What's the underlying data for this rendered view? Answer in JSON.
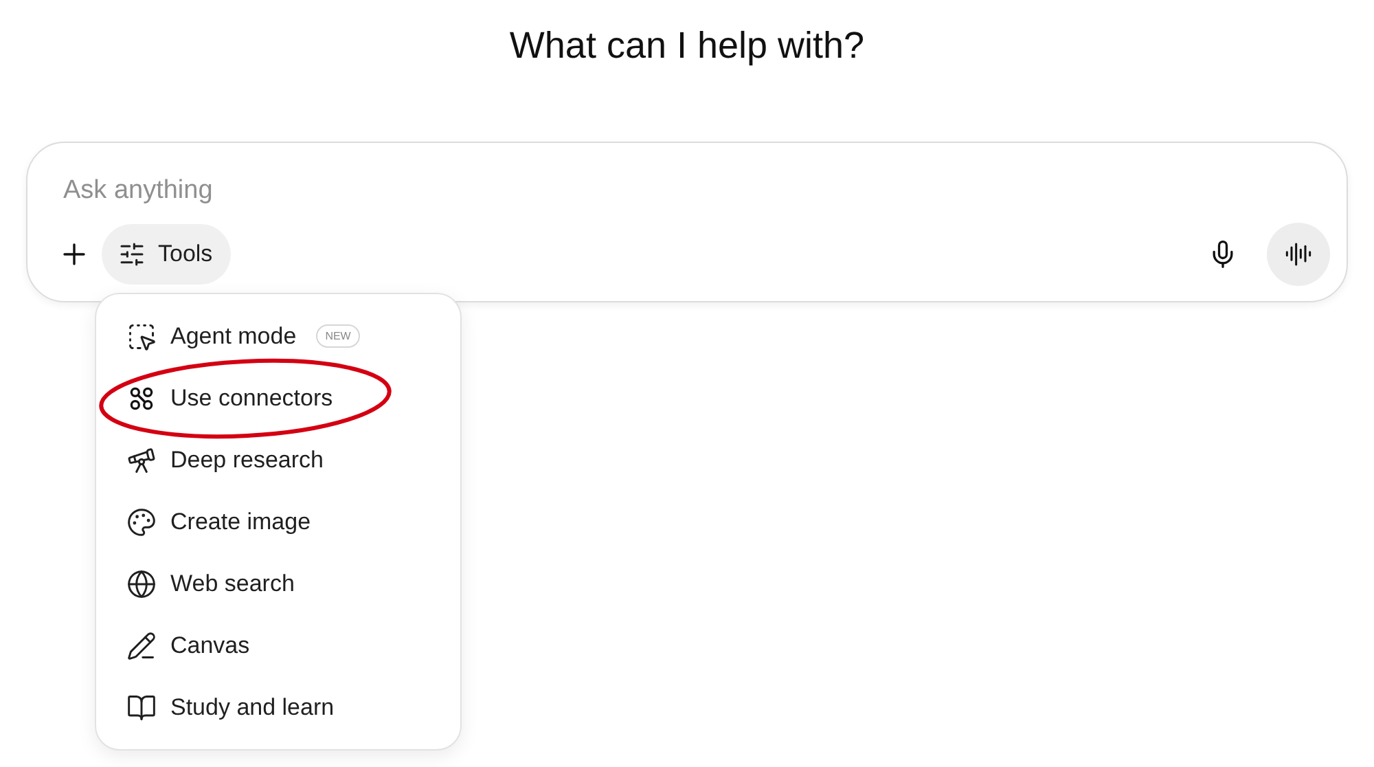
{
  "heading": "What can I help with?",
  "composer": {
    "placeholder": "Ask anything",
    "tools_label": "Tools"
  },
  "tools_menu": [
    {
      "label": "Agent mode",
      "badge": "NEW",
      "circled": false
    },
    {
      "label": "Use connectors",
      "circled": true
    },
    {
      "label": "Deep research",
      "circled": false
    },
    {
      "label": "Create image",
      "circled": false
    },
    {
      "label": "Web search",
      "circled": false
    },
    {
      "label": "Canvas",
      "circled": false
    },
    {
      "label": "Study and learn",
      "circled": false
    }
  ]
}
